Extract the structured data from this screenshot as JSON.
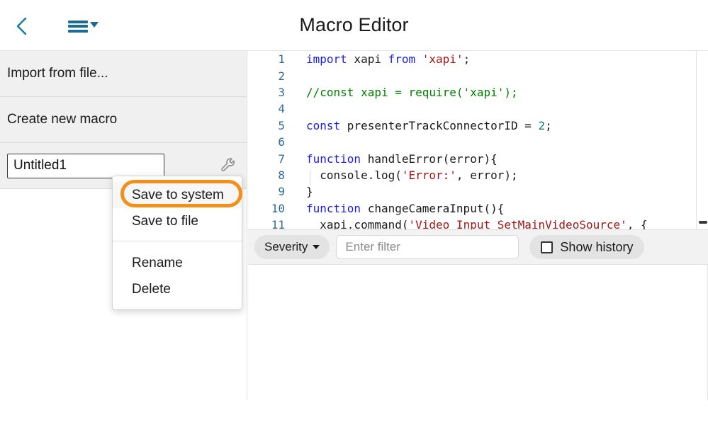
{
  "header": {
    "title": "Macro Editor",
    "back_icon": "chevron-left-icon",
    "menu_icon": "hamburger-menu-icon",
    "accent_blue": "#1b6c92"
  },
  "sidebar": {
    "items": [
      {
        "label": "Import from file..."
      },
      {
        "label": "Create new macro"
      }
    ],
    "macro": {
      "name_value": "Untitled1",
      "name_placeholder": "",
      "settings_icon": "wrench-icon"
    }
  },
  "context_menu": {
    "highlight_color": "#f39019",
    "items": [
      {
        "label": "Save to system",
        "highlighted": true
      },
      {
        "label": "Save to file",
        "highlighted": false
      },
      {
        "label": "Rename",
        "highlighted": false
      },
      {
        "label": "Delete",
        "highlighted": false
      }
    ]
  },
  "editor": {
    "lines": [
      {
        "n": "1",
        "tokens": [
          {
            "t": "import",
            "c": "kw"
          },
          {
            "t": " xapi ",
            "c": ""
          },
          {
            "t": "from",
            "c": "kw"
          },
          {
            "t": " ",
            "c": ""
          },
          {
            "t": "'xapi'",
            "c": "str"
          },
          {
            "t": ";",
            "c": ""
          }
        ]
      },
      {
        "n": "2",
        "tokens": []
      },
      {
        "n": "3",
        "tokens": [
          {
            "t": "//const xapi = require('xapi');",
            "c": "cmt"
          }
        ]
      },
      {
        "n": "4",
        "tokens": []
      },
      {
        "n": "5",
        "tokens": [
          {
            "t": "const",
            "c": "kw"
          },
          {
            "t": " presenterTrackConnectorID = ",
            "c": ""
          },
          {
            "t": "2",
            "c": "num"
          },
          {
            "t": ";",
            "c": ""
          }
        ]
      },
      {
        "n": "6",
        "tokens": []
      },
      {
        "n": "7",
        "tokens": [
          {
            "t": "function",
            "c": "kw"
          },
          {
            "t": " handleError(error){",
            "c": ""
          }
        ]
      },
      {
        "n": "8",
        "tokens": [
          {
            "t": "  console.log(",
            "c": ""
          },
          {
            "t": "'Error:'",
            "c": "str"
          },
          {
            "t": ", error);",
            "c": ""
          }
        ]
      },
      {
        "n": "9",
        "tokens": [
          {
            "t": "}",
            "c": ""
          }
        ]
      },
      {
        "n": "10",
        "tokens": [
          {
            "t": "function",
            "c": "kw"
          },
          {
            "t": " changeCameraInput(){",
            "c": ""
          }
        ]
      },
      {
        "n": "11",
        "tokens": [
          {
            "t": "  xapi.command(",
            "c": ""
          },
          {
            "t": "'Video Input SetMainVideoSource'",
            "c": "str"
          },
          {
            "t": ", {",
            "c": ""
          }
        ]
      }
    ]
  },
  "filter_bar": {
    "severity_label": "Severity",
    "severity_icon": "chevron-down-icon",
    "filter_placeholder": "Enter filter",
    "filter_value": "",
    "show_history_label": "Show history",
    "show_history_checked": false
  }
}
